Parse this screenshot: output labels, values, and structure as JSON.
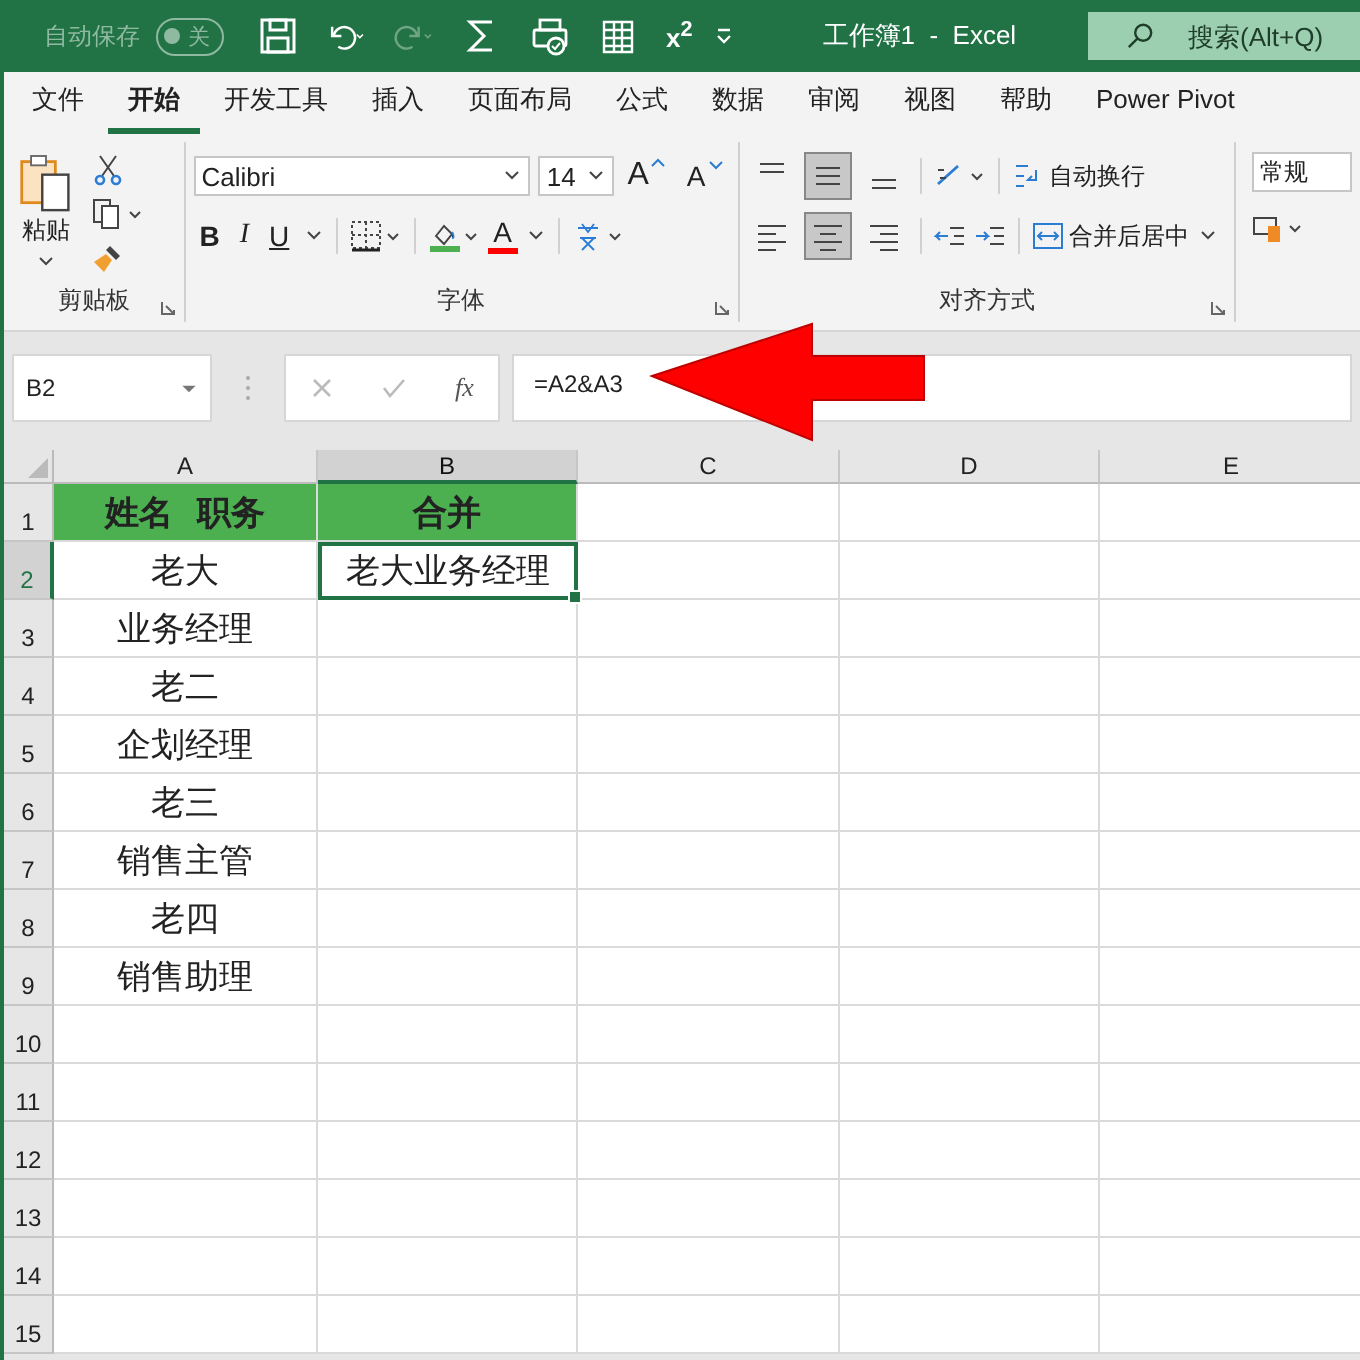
{
  "title_bar": {
    "autosave_label": "自动保存",
    "autosave_toggle": "关",
    "autosave_on": false,
    "superscript": "x$^{2}$",
    "title": "工作簿1  -  Excel",
    "search_placeholder": "搜索(Alt+Q)"
  },
  "tabs": [
    {
      "label": "文件",
      "selected": false
    },
    {
      "label": "开始",
      "selected": true
    },
    {
      "label": "开发工具",
      "selected": false
    },
    {
      "label": "插入",
      "selected": false
    },
    {
      "label": "页面布局",
      "selected": false
    },
    {
      "label": "公式",
      "selected": false
    },
    {
      "label": "数据",
      "selected": false
    },
    {
      "label": "审阅",
      "selected": false
    },
    {
      "label": "视图",
      "selected": false
    },
    {
      "label": "帮助",
      "selected": false
    },
    {
      "label": "Power Pivot",
      "selected": false
    }
  ],
  "ribbon": {
    "clipboard": {
      "paste": "粘贴",
      "label": "剪贴板"
    },
    "font": {
      "name": "Calibri",
      "size": "14",
      "grow": "A",
      "shrink": "A",
      "bold": "B",
      "italic": "I",
      "underline": "U",
      "font_color": "A",
      "label": "字体"
    },
    "alignment": {
      "vertical": [
        {
          "selected": false
        },
        {
          "selected": true
        },
        {
          "selected": false
        }
      ],
      "horizontal": [
        {
          "selected": false
        },
        {
          "selected": true
        },
        {
          "selected": false
        }
      ],
      "wrap": "自动换行",
      "merge": "合并后居中",
      "label": "对齐方式"
    },
    "number": {
      "format": "常规"
    }
  },
  "formula_bar": {
    "name_box": "B2",
    "fx": "fx",
    "formula": "=A2&A3"
  },
  "grid": {
    "columns": [
      {
        "label": "A",
        "selected": false
      },
      {
        "label": "B",
        "selected": true
      },
      {
        "label": "C",
        "selected": false
      },
      {
        "label": "D",
        "selected": false
      },
      {
        "label": "E",
        "selected": false
      }
    ],
    "rows": [
      {
        "number": "1",
        "selected": false,
        "kind": "header",
        "cells": [
          {
            "text": "姓名  职务",
            "active": false
          },
          {
            "text": "合并",
            "active": false
          }
        ]
      },
      {
        "number": "2",
        "selected": true,
        "kind": "data",
        "cells": [
          {
            "text": "老大",
            "active": false
          },
          {
            "text": "老大业务经理",
            "active": true
          }
        ]
      },
      {
        "number": "3",
        "selected": false,
        "kind": "data",
        "cells": [
          {
            "text": "业务经理",
            "active": false
          }
        ]
      },
      {
        "number": "4",
        "selected": false,
        "kind": "data",
        "cells": [
          {
            "text": "老二",
            "active": false
          }
        ]
      },
      {
        "number": "5",
        "selected": false,
        "kind": "data",
        "cells": [
          {
            "text": "企划经理",
            "active": false
          }
        ]
      },
      {
        "number": "6",
        "selected": false,
        "kind": "data",
        "cells": [
          {
            "text": "老三",
            "active": false
          }
        ]
      },
      {
        "number": "7",
        "selected": false,
        "kind": "data",
        "cells": [
          {
            "text": "销售主管",
            "active": false
          }
        ]
      },
      {
        "number": "8",
        "selected": false,
        "kind": "data",
        "cells": [
          {
            "text": "老四",
            "active": false
          }
        ]
      },
      {
        "number": "9",
        "selected": false,
        "kind": "data",
        "cells": [
          {
            "text": "销售助理",
            "active": false
          }
        ]
      },
      {
        "number": "10",
        "selected": false,
        "kind": "data"
      },
      {
        "number": "11",
        "selected": false,
        "kind": "data"
      },
      {
        "number": "12",
        "selected": false,
        "kind": "data"
      },
      {
        "number": "13",
        "selected": false,
        "kind": "data"
      },
      {
        "number": "14",
        "selected": false,
        "kind": "data"
      },
      {
        "number": "15",
        "selected": false,
        "kind": "data"
      }
    ]
  }
}
